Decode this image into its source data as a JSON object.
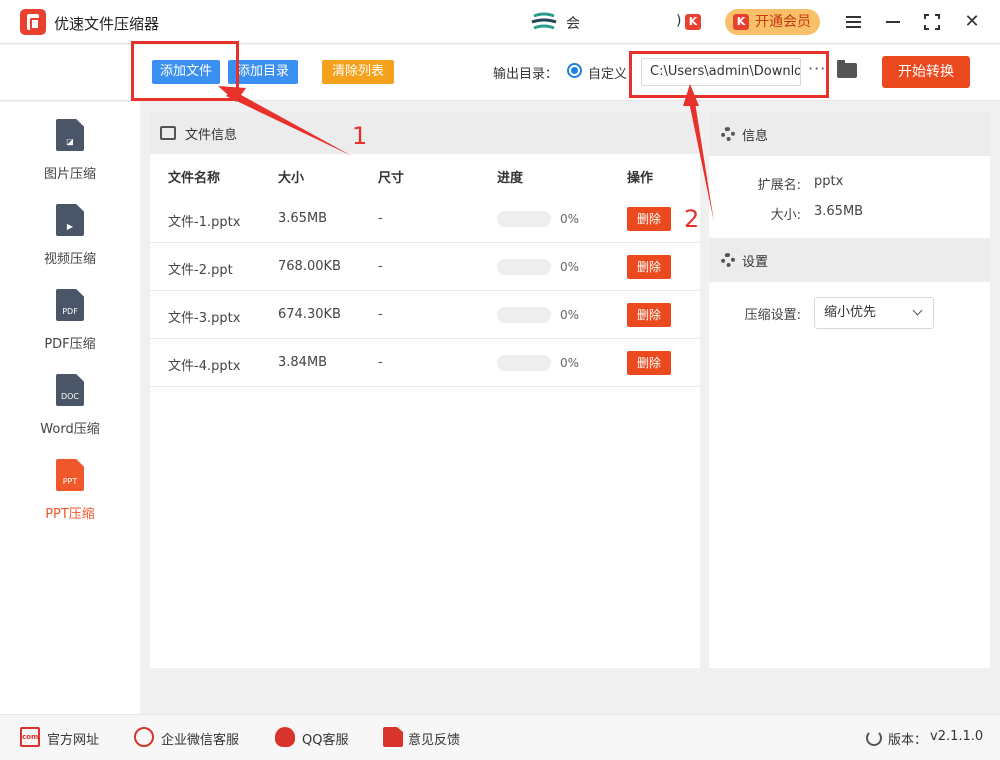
{
  "app": {
    "title": "优速文件压缩器",
    "brand_text": "会",
    "paren": ")",
    "k_badge": "K"
  },
  "header": {
    "vip_label": "开通会员",
    "close_glyph": "✕"
  },
  "toolbar": {
    "add_file": "添加文件",
    "add_dir": "添加目录",
    "clear_list": "清除列表",
    "output_label": "输出目录：",
    "custom_label": "自定义",
    "output_path": "C:\\Users\\admin\\Downloads",
    "more": "···",
    "start": "开始转换"
  },
  "sidebar": {
    "items": [
      {
        "label": "图片压缩",
        "badge": "◪",
        "active": false
      },
      {
        "label": "视频压缩",
        "badge": "▶",
        "active": false
      },
      {
        "label": "PDF压缩",
        "badge": "PDF",
        "active": false
      },
      {
        "label": "Word压缩",
        "badge": "DOC",
        "active": false
      },
      {
        "label": "PPT压缩",
        "badge": "PPT",
        "active": true
      }
    ]
  },
  "file_panel": {
    "title": "文件信息",
    "columns": [
      "文件名称",
      "大小",
      "尺寸",
      "进度",
      "操作"
    ],
    "rows": [
      {
        "name": "文件-1.pptx",
        "size": "3.65MB",
        "dim": "-",
        "progress": 0,
        "pct": "0%",
        "action": "删除"
      },
      {
        "name": "文件-2.ppt",
        "size": "768.00KB",
        "dim": "-",
        "progress": 0,
        "pct": "0%",
        "action": "删除"
      },
      {
        "name": "文件-3.pptx",
        "size": "674.30KB",
        "dim": "-",
        "progress": 0,
        "pct": "0%",
        "action": "删除"
      },
      {
        "name": "文件-4.pptx",
        "size": "3.84MB",
        "dim": "-",
        "progress": 0,
        "pct": "0%",
        "action": "删除"
      }
    ]
  },
  "info_panel": {
    "title": "信息",
    "ext_label": "扩展名:",
    "ext_value": "pptx",
    "size_label": "大小:",
    "size_value": "3.65MB"
  },
  "settings_panel": {
    "title": "设置",
    "compress_label": "压缩设置:",
    "compress_value": "缩小优先"
  },
  "footer": {
    "website": "官方网址",
    "com_badge": "com",
    "wechat": "企业微信客服",
    "qq": "QQ客服",
    "feedback": "意见反馈",
    "version_label": "版本：",
    "version_value": "v2.1.1.0"
  },
  "annotations": {
    "one": "1",
    "two": "2",
    "color": "#e8312a"
  },
  "colors": {
    "primary": "#3b8ff0",
    "accent": "#ea4a1e",
    "warning": "#f6a11b",
    "active": "#f0582b"
  }
}
